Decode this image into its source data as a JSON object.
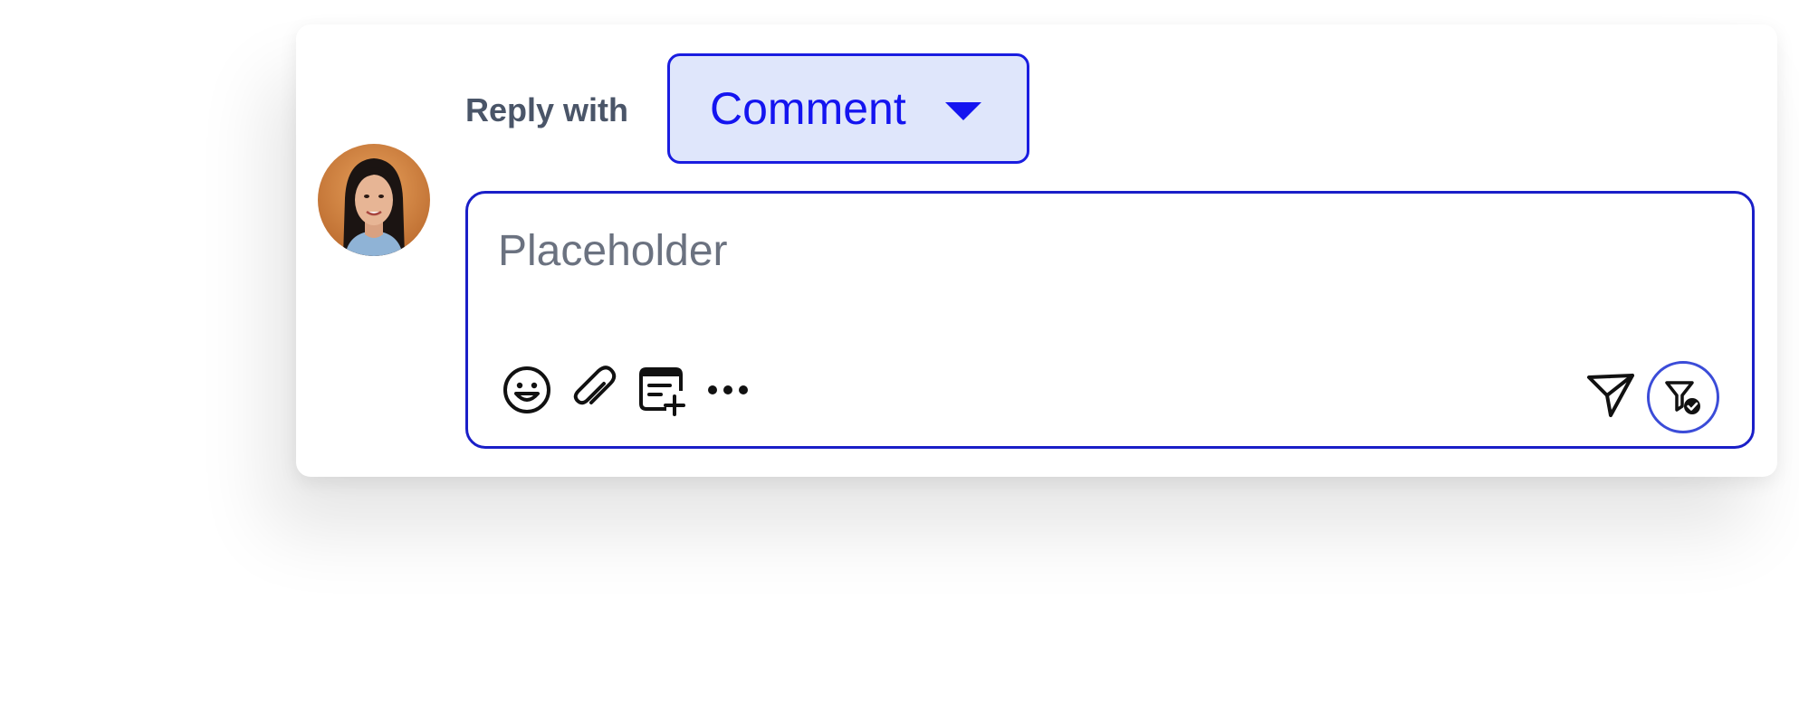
{
  "reply": {
    "label": "Reply with",
    "mode_selected": "Comment"
  },
  "composer": {
    "placeholder": "Placeholder",
    "value": "",
    "tools": [
      "emoji-icon",
      "paperclip-icon",
      "note-add-icon",
      "more-icon"
    ],
    "actions": [
      "send-icon",
      "filter-check-icon"
    ]
  },
  "colors": {
    "accent": "#1414f0",
    "select_bg": "#dfe6fb",
    "border": "#1a1fc8",
    "label": "#4a5568"
  }
}
